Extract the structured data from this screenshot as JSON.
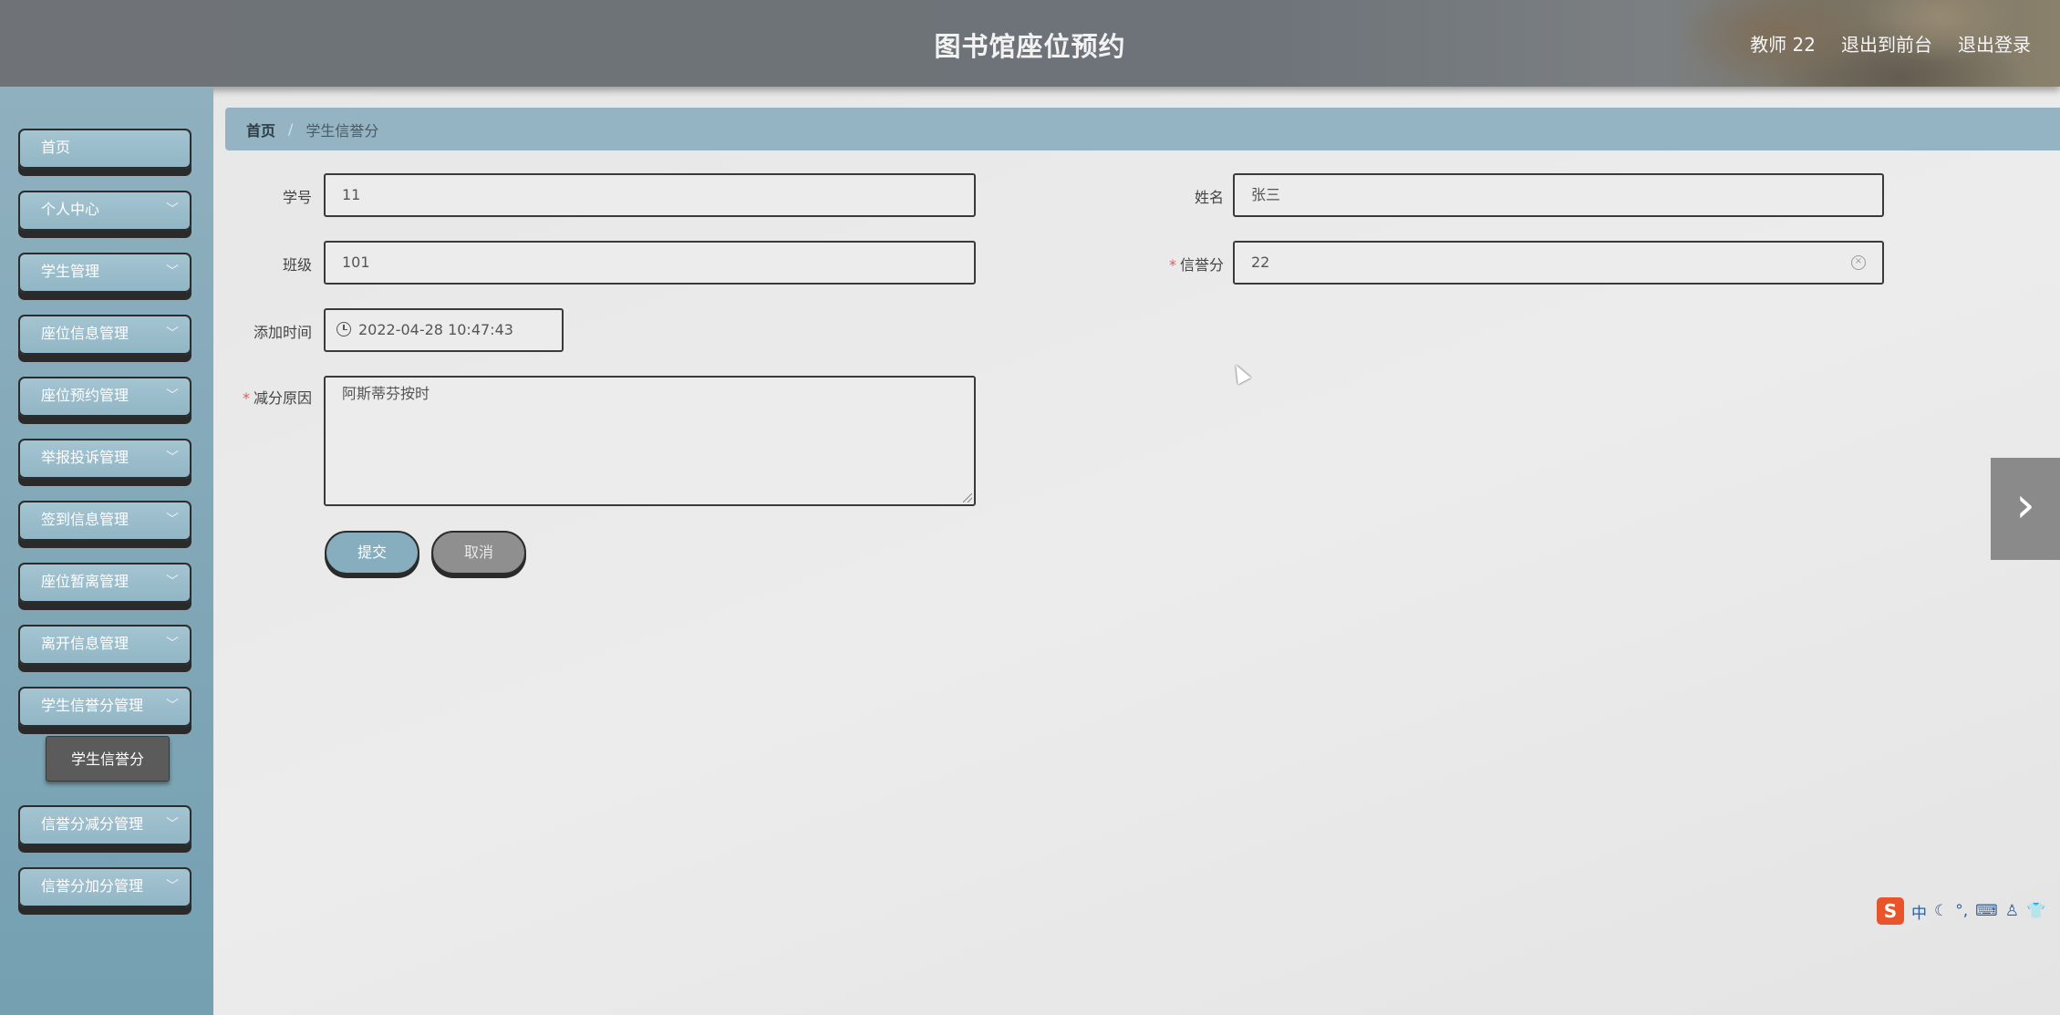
{
  "header": {
    "title": "图书馆座位预约",
    "user": "教师 22",
    "back_to_front": "退出到前台",
    "logout": "退出登录"
  },
  "sidebar": {
    "items": [
      {
        "label": "首页",
        "has_children": false
      },
      {
        "label": "个人中心",
        "has_children": true
      },
      {
        "label": "学生管理",
        "has_children": true
      },
      {
        "label": "座位信息管理",
        "has_children": true
      },
      {
        "label": "座位预约管理",
        "has_children": true
      },
      {
        "label": "举报投诉管理",
        "has_children": true
      },
      {
        "label": "签到信息管理",
        "has_children": true
      },
      {
        "label": "座位暂离管理",
        "has_children": true
      },
      {
        "label": "离开信息管理",
        "has_children": true
      },
      {
        "label": "学生信誉分管理",
        "has_children": true
      },
      {
        "label": "信誉分减分管理",
        "has_children": true
      },
      {
        "label": "信誉分加分管理",
        "has_children": true
      }
    ],
    "open_submenu_item": "学生信誉分"
  },
  "breadcrumb": {
    "home": "首页",
    "separator": "/",
    "current": "学生信誉分"
  },
  "form": {
    "student_no": {
      "label": "学号",
      "value": "11",
      "required": false
    },
    "name": {
      "label": "姓名",
      "value": "张三",
      "required": false
    },
    "class": {
      "label": "班级",
      "value": "101",
      "required": false
    },
    "credit": {
      "label": "信誉分",
      "value": "22",
      "required": true
    },
    "added_time": {
      "label": "添加时间",
      "value": "2022-04-28 10:47:43",
      "required": false
    },
    "reason": {
      "label": "减分原因",
      "value": "阿斯蒂芬按时",
      "required": true
    },
    "required_mark": "*",
    "submit_label": "提交",
    "cancel_label": "取消"
  },
  "icons": {
    "chevron": "chevron-down-icon",
    "clock": "clock-icon",
    "clear": "clear-icon",
    "next": "chevron-right-icon"
  },
  "ime": {
    "logo": "S",
    "mode": "中"
  },
  "colors": {
    "sidebar_bg": "#7fa6b6",
    "menu_item_bg": "#92b6c5",
    "breadcrumb_bg": "#94b4c3",
    "submit_bg": "#86aebe",
    "cancel_bg": "#8f8f8f",
    "submenu_bg": "#5b5b5b",
    "required_star": "#e05b5b"
  }
}
